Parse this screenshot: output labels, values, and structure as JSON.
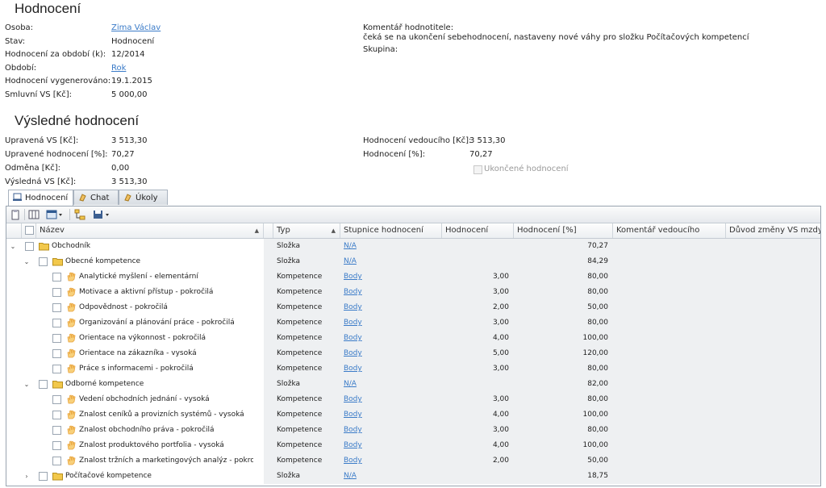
{
  "header": {
    "title": "Hodnocení",
    "fields": [
      {
        "label": "Osoba:",
        "value": "Zima Václav",
        "link": true
      },
      {
        "label": "Stav:",
        "value": "Hodnocení",
        "link": false
      },
      {
        "label": "Hodnocení za období (k):",
        "value": "12/2014",
        "link": false
      },
      {
        "label": "Období:",
        "value": "Rok",
        "link": true
      },
      {
        "label": "Hodnocení vygenerováno:",
        "value": "19.1.2015",
        "link": false
      },
      {
        "label": "Smluvní VS [Kč]:",
        "value": "5 000,00",
        "link": false
      }
    ],
    "comment_label": "Komentář hodnotitele:",
    "comment_text": "čeká se na ukončení sebehodnocení, nastaveny nové váhy pro složku Počítačových kompetencí",
    "group_label": "Skupina:"
  },
  "result": {
    "title": "Výsledné hodnocení",
    "left": [
      {
        "label": "Upravená VS [Kč]:",
        "value": "3 513,30"
      },
      {
        "label": "Upravené hodnocení [%]:",
        "value": "70,27"
      },
      {
        "label": "Odměna [Kč]:",
        "value": "0,00"
      },
      {
        "label": "Výsledná VS [Kč]:",
        "value": "3 513,30"
      }
    ],
    "right": [
      {
        "label": "Hodnocení vedoucího [Kč]:",
        "value": "3 513,30"
      },
      {
        "label": "Hodnocení [%]:",
        "value": "70,27"
      }
    ],
    "finished_label": "Ukončené hodnocení"
  },
  "tabs": [
    {
      "label": "Hodnocení",
      "icon": "evaluation-icon",
      "active": true
    },
    {
      "label": "Chat",
      "icon": "chat-icon",
      "active": false
    },
    {
      "label": "Úkoly",
      "icon": "tasks-icon",
      "active": false
    }
  ],
  "grid": {
    "columns": [
      "Název",
      "Typ",
      "Stupnice hodnocení",
      "Hodnocení",
      "Hodnocení [%]",
      "Komentář vedoucího",
      "Důvod změny VS mzdy"
    ],
    "rows": [
      {
        "level": 0,
        "expander": "collapse",
        "kind": "folder",
        "name": "Obchodník",
        "type": "Složka",
        "scale": "N/A",
        "score": "",
        "pct": "70,27"
      },
      {
        "level": 1,
        "expander": "collapse",
        "kind": "folder",
        "name": "Obecné kompetence",
        "type": "Složka",
        "scale": "N/A",
        "score": "",
        "pct": "84,29"
      },
      {
        "level": 2,
        "expander": "",
        "kind": "competence",
        "name": "Analytické myšlení - elementární",
        "type": "Kompetence",
        "scale": "Body",
        "score": "3,00",
        "pct": "80,00"
      },
      {
        "level": 2,
        "expander": "",
        "kind": "competence",
        "name": "Motivace a aktivní přístup - pokročilá",
        "type": "Kompetence",
        "scale": "Body",
        "score": "3,00",
        "pct": "80,00"
      },
      {
        "level": 2,
        "expander": "",
        "kind": "competence",
        "name": "Odpovědnost - pokročilá",
        "type": "Kompetence",
        "scale": "Body",
        "score": "2,00",
        "pct": "50,00"
      },
      {
        "level": 2,
        "expander": "",
        "kind": "competence",
        "name": "Organizování a plánování práce - pokročilá",
        "type": "Kompetence",
        "scale": "Body",
        "score": "3,00",
        "pct": "80,00"
      },
      {
        "level": 2,
        "expander": "",
        "kind": "competence",
        "name": "Orientace na výkonnost - pokročilá",
        "type": "Kompetence",
        "scale": "Body",
        "score": "4,00",
        "pct": "100,00"
      },
      {
        "level": 2,
        "expander": "",
        "kind": "competence",
        "name": "Orientace na zákazníka - vysoká",
        "type": "Kompetence",
        "scale": "Body",
        "score": "5,00",
        "pct": "120,00"
      },
      {
        "level": 2,
        "expander": "",
        "kind": "competence",
        "name": "Práce s informacemi - pokročilá",
        "type": "Kompetence",
        "scale": "Body",
        "score": "3,00",
        "pct": "80,00"
      },
      {
        "level": 1,
        "expander": "collapse",
        "kind": "folder",
        "name": "Odborné kompetence",
        "type": "Složka",
        "scale": "N/A",
        "score": "",
        "pct": "82,00"
      },
      {
        "level": 2,
        "expander": "",
        "kind": "competence",
        "name": "Vedení obchodních jednání - vysoká",
        "type": "Kompetence",
        "scale": "Body",
        "score": "3,00",
        "pct": "80,00"
      },
      {
        "level": 2,
        "expander": "",
        "kind": "competence",
        "name": "Znalost ceníků a provizních systémů - vysoká",
        "type": "Kompetence",
        "scale": "Body",
        "score": "4,00",
        "pct": "100,00"
      },
      {
        "level": 2,
        "expander": "",
        "kind": "competence",
        "name": "Znalost obchodního práva - pokročilá",
        "type": "Kompetence",
        "scale": "Body",
        "score": "3,00",
        "pct": "80,00"
      },
      {
        "level": 2,
        "expander": "",
        "kind": "competence",
        "name": "Znalost produktového portfolia - vysoká",
        "type": "Kompetence",
        "scale": "Body",
        "score": "4,00",
        "pct": "100,00"
      },
      {
        "level": 2,
        "expander": "",
        "kind": "competence",
        "name": "Znalost tržních a marketingových analýz - pokročilá",
        "type": "Kompetence",
        "scale": "Body",
        "score": "2,00",
        "pct": "50,00"
      },
      {
        "level": 1,
        "expander": "expand",
        "kind": "folder",
        "name": "Počítačové kompetence",
        "type": "Složka",
        "scale": "N/A",
        "score": "",
        "pct": "18,75"
      }
    ]
  },
  "toolbar": [
    "clipboard-icon",
    "columns-icon",
    "view-dropdown-icon",
    "tree-icon",
    "save-dropdown-icon"
  ],
  "colors": {
    "link": "#3a7bc8",
    "folder": "#f2c84b",
    "hand": "#e8a33c",
    "grid_border": "#99a4b0"
  }
}
